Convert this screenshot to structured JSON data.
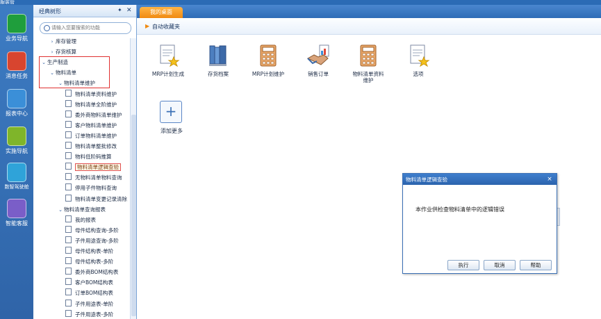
{
  "app": {
    "title_fragment": "服装管"
  },
  "left_nav": [
    {
      "label": "业务导航",
      "icon": "sitemap-icon",
      "color": "#1f9e3c"
    },
    {
      "label": "消息任务",
      "icon": "mail-icon",
      "color": "#d8452f"
    },
    {
      "label": "报表中心",
      "icon": "report-icon",
      "color": "#3b8fd8"
    },
    {
      "label": "实施导航",
      "icon": "compass-icon",
      "color": "#7fb52a"
    },
    {
      "label": "数智驾驶舱",
      "icon": "cube-icon",
      "color": "#2fa3d9"
    },
    {
      "label": "智能客服",
      "icon": "headset-icon",
      "color": "#7a5ec8"
    }
  ],
  "tree": {
    "title": "经典树形",
    "search_placeholder": "请输入您要搜索的功能",
    "nodes": [
      {
        "label": "库存管理",
        "type": "folder",
        "arrow": "›"
      },
      {
        "label": "存货核算",
        "type": "folder",
        "arrow": "›"
      },
      {
        "label": "生产制造",
        "type": "folder",
        "arrow": "⌄"
      },
      {
        "label": "物料清单",
        "type": "folder",
        "arrow": "⌄"
      },
      {
        "label": "物料清单维护",
        "type": "folder",
        "arrow": "⌄"
      },
      {
        "label": "物料清单资料维护",
        "type": "leaf"
      },
      {
        "label": "物料清单全阶维护",
        "type": "leaf"
      },
      {
        "label": "委外商物料清单维护",
        "type": "leaf"
      },
      {
        "label": "客户物料清单维护",
        "type": "leaf"
      },
      {
        "label": "订单物料清单维护",
        "type": "leaf"
      },
      {
        "label": "物料清单整批修改",
        "type": "leaf"
      },
      {
        "label": "物料低阶码推算",
        "type": "leaf"
      },
      {
        "label": "物料清单逻辑查验",
        "type": "leaf",
        "selected": true
      },
      {
        "label": "无物料清单物料查询",
        "type": "leaf"
      },
      {
        "label": "停用子件物料查询",
        "type": "leaf"
      },
      {
        "label": "物料清单变更记录清除",
        "type": "leaf"
      },
      {
        "label": "物料清单查询报表",
        "type": "folder",
        "arrow": "⌄"
      },
      {
        "label": "我的报表",
        "type": "leaf"
      },
      {
        "label": "母件结构查询-多阶",
        "type": "leaf"
      },
      {
        "label": "子件用途查询-多阶",
        "type": "leaf"
      },
      {
        "label": "母件结构表-单阶",
        "type": "leaf"
      },
      {
        "label": "母件结构表-多阶",
        "type": "leaf"
      },
      {
        "label": "委外商BOM结构表",
        "type": "leaf"
      },
      {
        "label": "客户BOM结构表",
        "type": "leaf"
      },
      {
        "label": "订单BOM结构表",
        "type": "leaf"
      },
      {
        "label": "子件用途表-单阶",
        "type": "leaf"
      },
      {
        "label": "子件用途表-多阶",
        "type": "leaf"
      }
    ]
  },
  "main": {
    "tab_label": "我的桌面",
    "favorites_label": "自动收藏夹",
    "favorites": [
      {
        "label": "MRP计划生成",
        "icon": "doc-star-icon"
      },
      {
        "label": "存货档案",
        "icon": "books-icon"
      },
      {
        "label": "MRP计划维护",
        "icon": "calculator-icon"
      },
      {
        "label": "销售订单",
        "icon": "handshake-icon"
      },
      {
        "label": "物料清单资料维护",
        "icon": "calculator-icon"
      },
      {
        "label": "选项",
        "icon": "doc-star-icon"
      }
    ],
    "add_more_label": "添加更多",
    "add_more_symbol": "+"
  },
  "dialog": {
    "title": "物料清单逻辑查验",
    "close_symbol": "×",
    "message": "本作业供检查物料清单中的逻辑错误",
    "buttons": {
      "execute": "执行",
      "cancel": "取消",
      "help": "帮助"
    }
  }
}
